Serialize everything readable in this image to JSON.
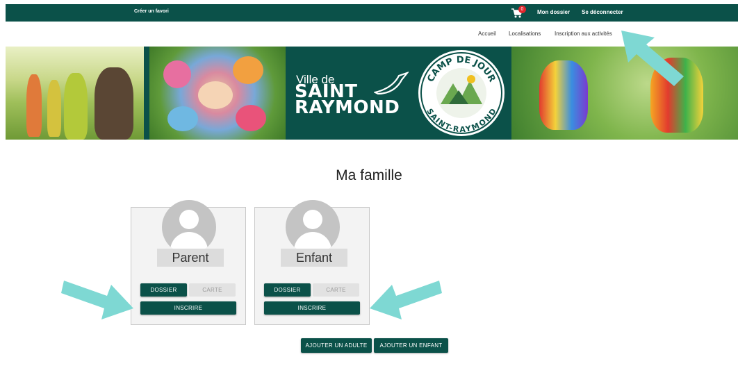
{
  "topbar": {
    "favorite_label": "Créer un favori",
    "cart_count": "0",
    "cart_icon": "shopping-cart-icon",
    "my_file_label": "Mon dossier",
    "logout_label": "Se déconnecter"
  },
  "nav": {
    "items": [
      "Accueil",
      "Localisations",
      "Inscription aux activités"
    ]
  },
  "banner": {
    "ville_label": "Ville de",
    "city_line1": "SAINT",
    "city_line2": "RAYMOND",
    "seal_top": "CAMP DE JOUR",
    "seal_bottom": "SAINT-RAYMOND",
    "seal_inner": "SAINT RAYMOND"
  },
  "main": {
    "title": "Ma famille",
    "cards": [
      {
        "label": "Parent",
        "dossier": "DOSSIER",
        "carte": "CARTE",
        "inscrire": "INSCRIRE"
      },
      {
        "label": "Enfant",
        "dossier": "DOSSIER",
        "carte": "CARTE",
        "inscrire": "INSCRIRE"
      }
    ],
    "add_adult": "AJOUTER UN ADULTE",
    "add_child": "AJOUTER UN ENFANT"
  },
  "colors": {
    "brand": "#0b5149",
    "badge": "#e0262d",
    "arrow": "#7ed8d3"
  }
}
